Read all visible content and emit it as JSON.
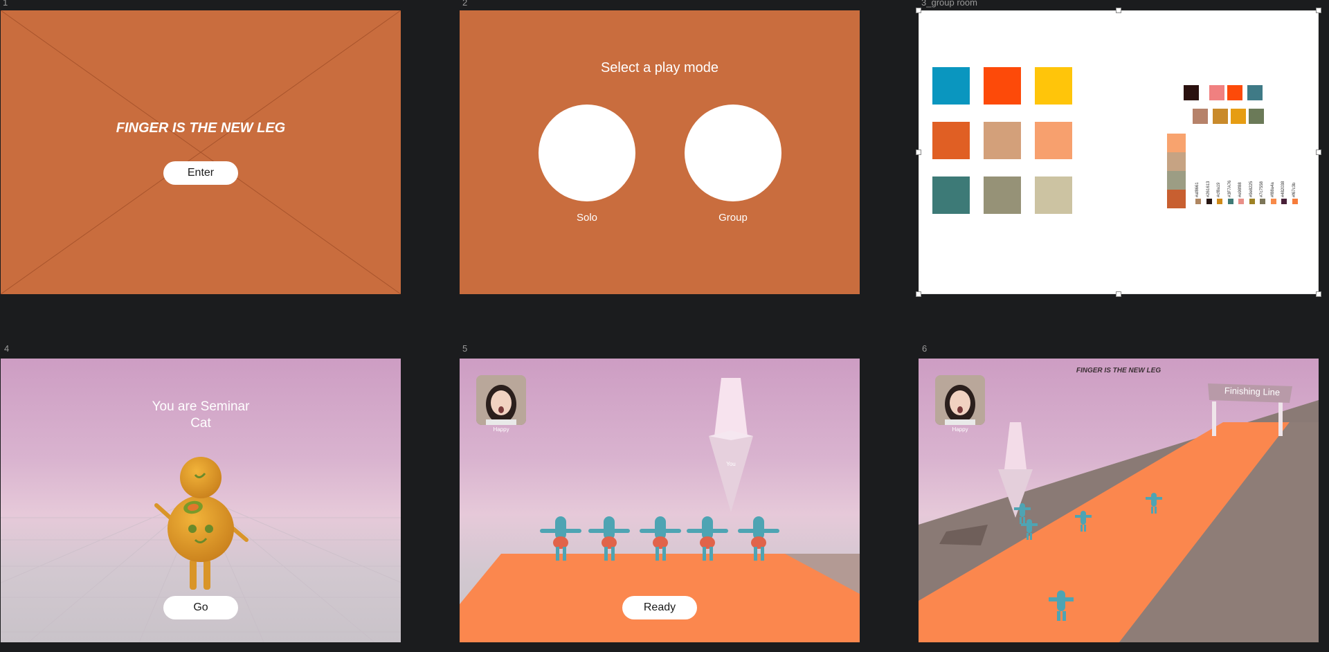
{
  "frames": {
    "f1": {
      "label": "1",
      "title": "FINGER IS THE NEW LEG",
      "button": "Enter"
    },
    "f2": {
      "label": "2",
      "heading": "Select a play mode",
      "options": [
        "Solo",
        "Group"
      ]
    },
    "f3": {
      "label": "3_group room",
      "grid_colors": [
        "#0a96bf",
        "#fd4a09",
        "#ffc50a",
        "#e05f24",
        "#d3a07a",
        "#f7a06e",
        "#3d7a77",
        "#969277",
        "#ccc3a2"
      ],
      "small_top": [
        "#2a110f",
        "#f08080",
        "#fd4a09",
        "#3f7a86"
      ],
      "small_second": [
        "#b6826a",
        "#c98a2b",
        "#e69d13",
        "#6b7a58"
      ],
      "stack": [
        "#f8a36e",
        "#c6a383",
        "#9c9d84",
        "#c85f30"
      ],
      "hex_labels": [
        "#af8661",
        "#261613",
        "#cf8a19",
        "#3F7A76",
        "#e98f88",
        "#9e8225",
        "#7c7558",
        "#f88a4a",
        "#482038",
        "#f67c3b"
      ],
      "hex_dots": [
        "#af8661",
        "#261613",
        "#cf8a19",
        "#3f7a76",
        "#e98f88",
        "#9e8225",
        "#7c7558",
        "#f88a4a",
        "#482038",
        "#f67c3b"
      ]
    },
    "f4": {
      "label": "4",
      "heading_line1": "You are Seminar",
      "heading_line2": "Cat",
      "button": "Go"
    },
    "f5": {
      "label": "5",
      "avatar_caption": "Happy",
      "marker_text": "You",
      "button": "Ready"
    },
    "f6": {
      "label": "6",
      "avatar_caption": "Happy",
      "title": "FINGER IS THE NEW LEG",
      "finish_text": "Finishing Line"
    }
  },
  "colors": {
    "canvas_bg": "#1b1c1e",
    "orange_frame": "#c96d3e",
    "track_orange": "#fb874e",
    "character_teal": "#4ea4b3"
  }
}
